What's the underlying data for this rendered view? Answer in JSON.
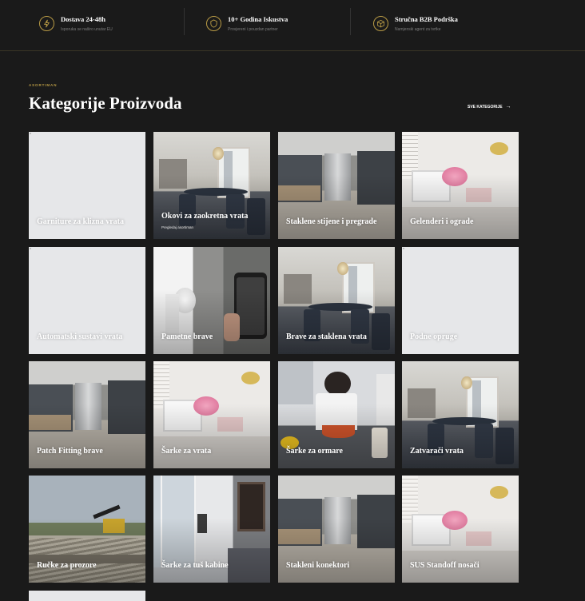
{
  "features": [
    {
      "icon": "lightning-icon",
      "title": "Dostava 24-48h",
      "subtitle": "Isporuka se naširo unutar EU"
    },
    {
      "icon": "shield-icon",
      "title": "10+ Godina Iskustva",
      "subtitle": "Provjereni i pouzdan partner"
    },
    {
      "icon": "box-icon",
      "title": "Stručna B2B Podrška",
      "subtitle": "Namjenski agent za tvrtke"
    }
  ],
  "section": {
    "eyebrow": "ASORTIMAN",
    "title": "Kategorije Proizvoda",
    "all_link": "SVE KATEGORIJE"
  },
  "categories": [
    {
      "label": "Garniture za klizna vrata",
      "scene": "blank"
    },
    {
      "label": "Okovi za zaokretna vrata",
      "hint": "Pregledaj asortiman",
      "scene": "dining"
    },
    {
      "label": "Staklene stijene i pregrade",
      "scene": "office"
    },
    {
      "label": "Gelenderi i ograde",
      "scene": "desk"
    },
    {
      "label": "Automatski sustavi vrata",
      "scene": "blank"
    },
    {
      "label": "Pametne brave",
      "scene": "phone"
    },
    {
      "label": "Brave za staklena vrata",
      "scene": "dining"
    },
    {
      "label": "Podne opruge",
      "scene": "blank"
    },
    {
      "label": "Patch Fitting brave",
      "scene": "office"
    },
    {
      "label": "Šarke za vrata",
      "scene": "desk"
    },
    {
      "label": "Šarke za ormare",
      "scene": "kitchen"
    },
    {
      "label": "Zatvarači vrata",
      "scene": "dining"
    },
    {
      "label": "Ručke za prozore",
      "scene": "construction"
    },
    {
      "label": "Šarke za tuš kabine",
      "scene": "bathroom"
    },
    {
      "label": "Stakleni konektori",
      "scene": "office"
    },
    {
      "label": "SUS Standoff nosači",
      "scene": "desk"
    }
  ],
  "colors": {
    "accent": "#b99b45",
    "background": "#1a1a1a",
    "card": "#e6e7e9"
  }
}
